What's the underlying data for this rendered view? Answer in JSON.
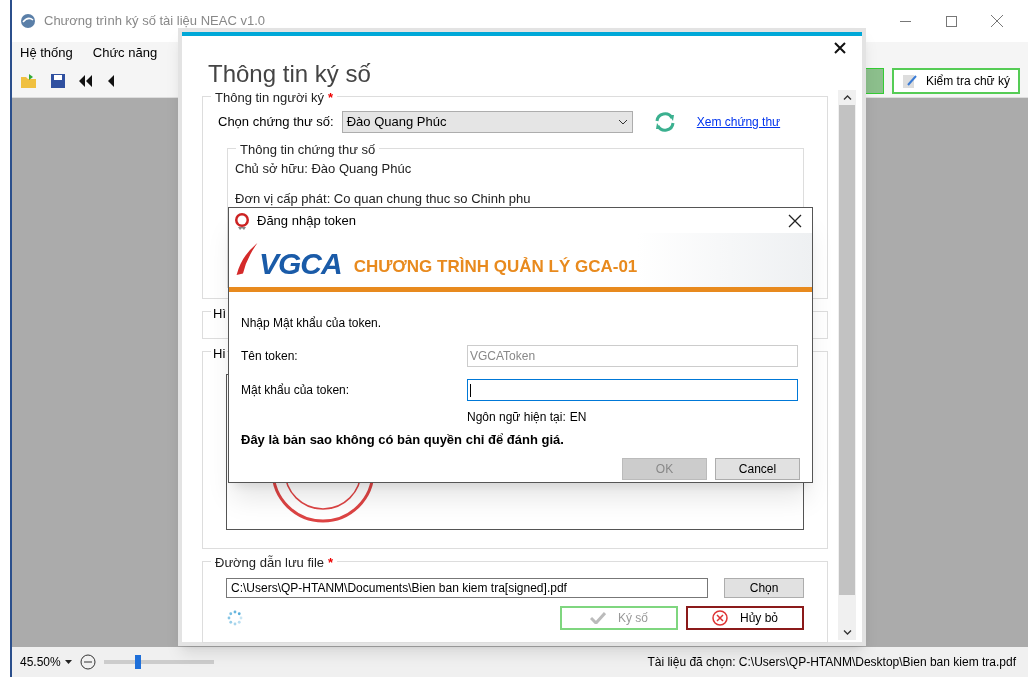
{
  "main_window": {
    "title": "Chương trình ký số tài liệu NEAC v1.0",
    "menu": [
      "Hệ thống",
      "Chức năng"
    ],
    "toolbar_button": "Kiểm tra chữ ký",
    "status_bar": {
      "zoom": "45.50%",
      "zoom_slider": {
        "level": 0.3
      },
      "selected_file": "Tài liệu đã chọn: C:\\Users\\QP-HTANM\\Desktop\\Bien ban kiem tra.pdf"
    }
  },
  "sign_dialog": {
    "title": "Thông tin ký số",
    "signer": {
      "label": "Thông tin người ký",
      "required": "*",
      "cert_label": "Chọn chứng thư số:",
      "cert_value": "Đào Quang Phúc",
      "link": "Xem chứng thư",
      "cert_info": {
        "title": "Thông tin chứng thư số",
        "lines": [
          "Chủ sở hữu: Đào Quang Phúc",
          "Đơn vị cấp phát: Co quan chung thuc so Chinh phu"
        ]
      }
    },
    "sections": [
      "Hì",
      "Hi"
    ],
    "save_path": {
      "label": "Đường dẫn lưu file",
      "required": "*",
      "value": "C:\\Users\\QP-HTANM\\Documents\\Bien ban kiem tra[signed].pdf",
      "browse": "Chọn"
    },
    "buttons": [
      {
        "kind": "sign",
        "label": "Ký số",
        "disabled": true
      },
      {
        "kind": "cancel",
        "label": "Hủy bỏ",
        "disabled": false
      }
    ]
  },
  "token_dialog": {
    "title": "Đăng nhập token",
    "logo": "VGCA",
    "banner": "CHƯƠNG TRÌNH QUẢN LÝ GCA-01",
    "instruction": "Nhập Mật khẩu của token.",
    "fields": [
      {
        "label": "Tên token:",
        "value": "VGCAToken",
        "disabled": true,
        "focused": false
      },
      {
        "label": "Mật khẩu của token:",
        "disabled": false,
        "focused": true
      }
    ],
    "language_label": "Ngôn ngữ hiện tại:",
    "language": "EN",
    "notice": "Đây là bản sao không có bản quyền chỉ để đánh giá.",
    "buttons": [
      {
        "label": "OK",
        "disabled": true
      },
      {
        "label": "Cancel",
        "disabled": false
      }
    ]
  }
}
